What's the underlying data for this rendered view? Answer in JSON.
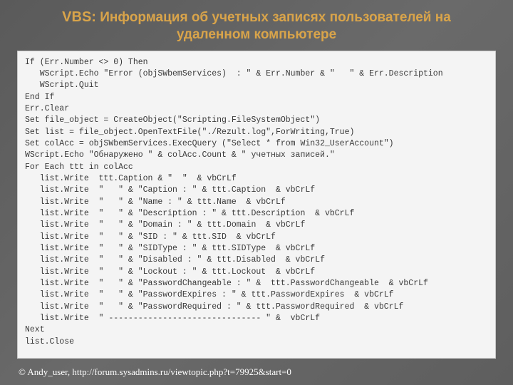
{
  "title_prefix": "VBS:",
  "title_rest": " Информация об учетных записях пользователей на удаленном компьютере",
  "code_lines": [
    "If (Err.Number <> 0) Then",
    "   WScript.Echo \"Error (objSWbemServices)  : \" & Err.Number & \"   \" & Err.Description",
    "   WScript.Quit",
    "End If",
    "Err.Clear",
    "Set file_object = CreateObject(\"Scripting.FileSystemObject\")",
    "Set list = file_object.OpenTextFile(\"./Rezult.log\",ForWriting,True)",
    "Set colAcc = objSWbemServices.ExecQuery (\"Select * from Win32_UserAccount\")",
    "WScript.Echo \"Обнаружено \" & colAcc.Count & \" учетных записей.\"",
    "For Each ttt in colAcc",
    "   list.Write  ttt.Caption & \"  \"  & vbCrLf",
    "   list.Write  \"   \" & \"Caption : \" & ttt.Caption  & vbCrLf",
    "   list.Write  \"   \" & \"Name : \" & ttt.Name  & vbCrLf",
    "   list.Write  \"   \" & \"Description : \" & ttt.Description  & vbCrLf",
    "   list.Write  \"   \" & \"Domain : \" & ttt.Domain  & vbCrLf",
    "   list.Write  \"   \" & \"SID : \" & ttt.SID  & vbCrLf",
    "   list.Write  \"   \" & \"SIDType : \" & ttt.SIDType  & vbCrLf",
    "   list.Write  \"   \" & \"Disabled : \" & ttt.Disabled  & vbCrLf",
    "   list.Write  \"   \" & \"Lockout : \" & ttt.Lockout  & vbCrLf",
    "   list.Write  \"   \" & \"PasswordChangeable : \" &  ttt.PasswordChangeable  & vbCrLf",
    "   list.Write  \"   \" & \"PasswordExpires : \" & ttt.PasswordExpires  & vbCrLf",
    "   list.Write  \"   \" & \"PasswordRequired : \" & ttt.PasswordRequired  & vbCrLf",
    "   list.Write  \" ------------------------------- \" &  vbCrLf",
    "Next",
    "list.Close"
  ],
  "footer": "© Andy_user, http://forum.sysadmins.ru/viewtopic.php?t=79925&start=0"
}
